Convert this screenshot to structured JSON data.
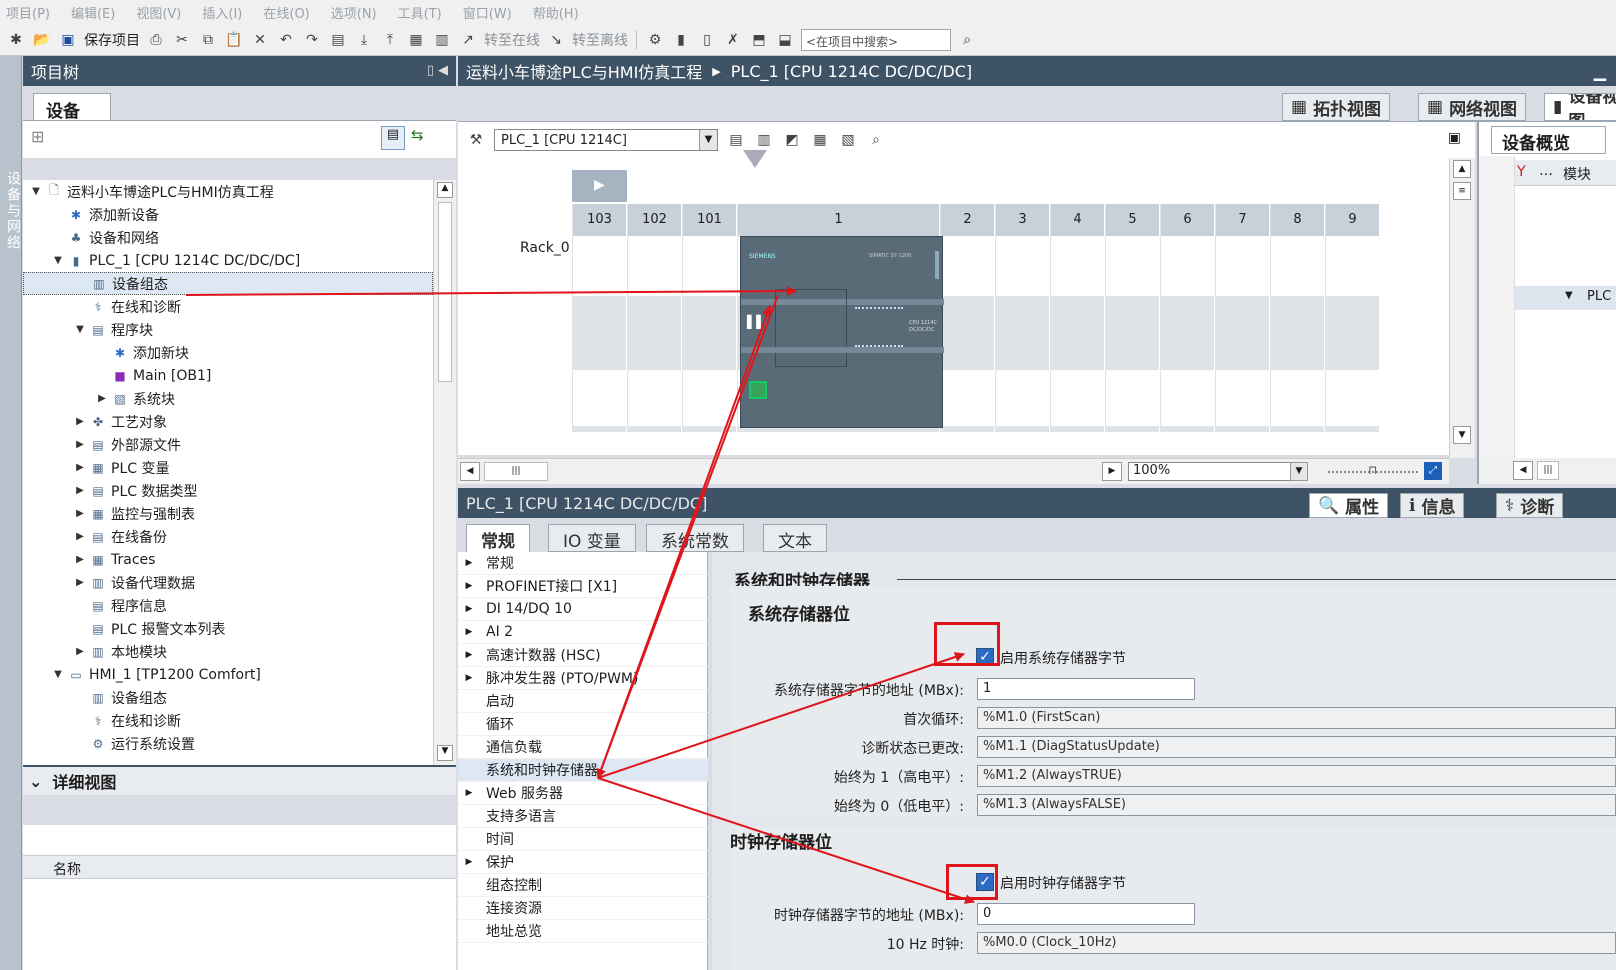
{
  "menu": [
    "项目(P)",
    "编辑(E)",
    "视图(V)",
    "插入(I)",
    "在线(O)",
    "选项(N)",
    "工具(T)",
    "窗口(W)",
    "帮助(H)"
  ],
  "toolbar": {
    "save_label": "保存项目",
    "go_online": "转至在线",
    "go_offline": "转至离线",
    "search_placeholder": "<在项目中搜索>"
  },
  "left_strip_label": "设备与网络",
  "project_tree": {
    "title": "项目树",
    "tab": "设备",
    "items": [
      {
        "label": "运料小车博途PLC与HMI仿真工程",
        "level": 0,
        "exp": "▼",
        "icon": "project-icon"
      },
      {
        "label": "添加新设备",
        "level": 1,
        "exp": "",
        "icon": "add-device-icon"
      },
      {
        "label": "设备和网络",
        "level": 1,
        "exp": "",
        "icon": "network-icon"
      },
      {
        "label": "PLC_1 [CPU 1214C DC/DC/DC]",
        "level": 1,
        "exp": "▼",
        "icon": "plc-icon"
      },
      {
        "label": "设备组态",
        "level": 2,
        "exp": "",
        "icon": "device-config-icon",
        "selected": true
      },
      {
        "label": "在线和诊断",
        "level": 2,
        "exp": "",
        "icon": "diagnostics-icon"
      },
      {
        "label": "程序块",
        "level": 2,
        "exp": "▼",
        "icon": "folder-icon"
      },
      {
        "label": "添加新块",
        "level": 3,
        "exp": "",
        "icon": "add-block-icon"
      },
      {
        "label": "Main [OB1]",
        "level": 3,
        "exp": "",
        "icon": "ob-icon"
      },
      {
        "label": "系统块",
        "level": 3,
        "exp": "▶",
        "icon": "system-block-icon"
      },
      {
        "label": "工艺对象",
        "level": 2,
        "exp": "▶",
        "icon": "tech-object-icon"
      },
      {
        "label": "外部源文件",
        "level": 2,
        "exp": "▶",
        "icon": "external-file-icon"
      },
      {
        "label": "PLC 变量",
        "level": 2,
        "exp": "▶",
        "icon": "tag-icon"
      },
      {
        "label": "PLC 数据类型",
        "level": 2,
        "exp": "▶",
        "icon": "datatype-icon"
      },
      {
        "label": "监控与强制表",
        "level": 2,
        "exp": "▶",
        "icon": "watch-table-icon"
      },
      {
        "label": "在线备份",
        "level": 2,
        "exp": "▶",
        "icon": "backup-icon"
      },
      {
        "label": "Traces",
        "level": 2,
        "exp": "▶",
        "icon": "trace-icon"
      },
      {
        "label": "设备代理数据",
        "level": 2,
        "exp": "▶",
        "icon": "proxy-icon"
      },
      {
        "label": "程序信息",
        "level": 2,
        "exp": "",
        "icon": "program-info-icon"
      },
      {
        "label": "PLC 报警文本列表",
        "level": 2,
        "exp": "",
        "icon": "alarm-text-icon"
      },
      {
        "label": "本地模块",
        "level": 2,
        "exp": "▶",
        "icon": "local-module-icon"
      },
      {
        "label": "HMI_1 [TP1200 Comfort]",
        "level": 1,
        "exp": "▼",
        "icon": "hmi-icon"
      },
      {
        "label": "设备组态",
        "level": 2,
        "exp": "",
        "icon": "device-config-icon"
      },
      {
        "label": "在线和诊断",
        "level": 2,
        "exp": "",
        "icon": "diagnostics-icon"
      },
      {
        "label": "运行系统设置",
        "level": 2,
        "exp": "",
        "icon": "runtime-icon"
      }
    ]
  },
  "detail_view": {
    "title": "详细视图",
    "col_name": "名称"
  },
  "editor": {
    "breadcrumb_project": "运料小车博途PLC与HMI仿真工程",
    "breadcrumb_device": "PLC_1 [CPU 1214C DC/DC/DC]",
    "view_tabs": [
      "拓扑视图",
      "网络视图",
      "设备视图"
    ],
    "device_select": "PLC_1 [CPU 1214C]",
    "rack_label": "Rack_0",
    "slots": [
      "103",
      "102",
      "101",
      "1",
      "2",
      "3",
      "4",
      "5",
      "6",
      "7",
      "8",
      "9"
    ],
    "zoom": "100%",
    "cpu_brand": "SIEMENS",
    "cpu_model": "SIMATIC S7-1200",
    "cpu_type": "CPU 1214C DC/DC/DC"
  },
  "overview": {
    "title": "设备概览",
    "col_module": "模块",
    "row_plc": "PLC"
  },
  "properties": {
    "header": "PLC_1 [CPU 1214C DC/DC/DC]",
    "tabs": [
      "属性",
      "信息",
      "诊断"
    ],
    "subtabs": [
      "常规",
      "IO 变量",
      "系统常数",
      "文本"
    ],
    "nav": [
      {
        "label": "常规",
        "exp": "▶"
      },
      {
        "label": "PROFINET接口 [X1]",
        "exp": "▶"
      },
      {
        "label": "DI 14/DQ 10",
        "exp": "▶"
      },
      {
        "label": "AI 2",
        "exp": "▶"
      },
      {
        "label": "高速计数器 (HSC)",
        "exp": "▶"
      },
      {
        "label": "脉冲发生器 (PTO/PWM)",
        "exp": "▶"
      },
      {
        "label": "启动",
        "exp": ""
      },
      {
        "label": "循环",
        "exp": ""
      },
      {
        "label": "通信负载",
        "exp": ""
      },
      {
        "label": "系统和时钟存储器",
        "exp": "",
        "selected": true
      },
      {
        "label": "Web 服务器",
        "exp": "▶"
      },
      {
        "label": "支持多语言",
        "exp": ""
      },
      {
        "label": "时间",
        "exp": ""
      },
      {
        "label": "保护",
        "exp": "▶"
      },
      {
        "label": "组态控制",
        "exp": ""
      },
      {
        "label": "连接资源",
        "exp": ""
      },
      {
        "label": "地址总览",
        "exp": ""
      }
    ],
    "section_title": "系统和时钟存储器",
    "sys_title": "系统存储器位",
    "sys_enable": "启用系统存储器字节",
    "sys_addr_label": "系统存储器字节的地址 (MBx):",
    "sys_addr_value": "1",
    "first_scan_label": "首次循环:",
    "first_scan_value": "%M1.0 (FirstScan)",
    "diag_label": "诊断状态已更改:",
    "diag_value": "%M1.1 (DiagStatusUpdate)",
    "always_true_label": "始终为 1（高电平）:",
    "always_true_value": "%M1.2 (AlwaysTRUE)",
    "always_false_label": "始终为 0（低电平）:",
    "always_false_value": "%M1.3 (AlwaysFALSE)",
    "clock_title": "时钟存储器位",
    "clock_enable": "启用时钟存储器字节",
    "clock_addr_label": "时钟存储器字节的地址 (MBx):",
    "clock_addr_value": "0",
    "clock_10hz_label": "10 Hz 时钟:",
    "clock_10hz_value": "%M0.0 (Clock_10Hz)"
  },
  "colors": {
    "header": "#3e5365",
    "arrow": "#e0141b",
    "checkbox": "#2a6bc4"
  }
}
